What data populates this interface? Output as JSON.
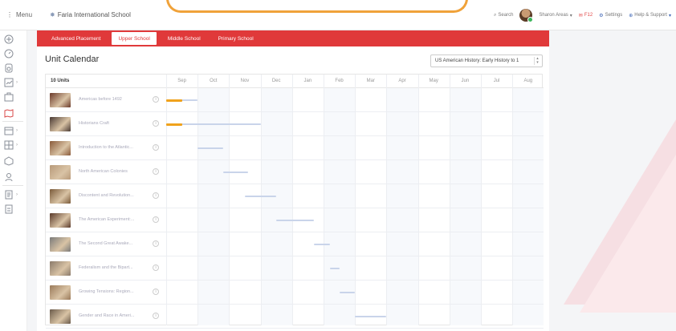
{
  "topbar": {
    "menu_label": "Menu",
    "school_name": "Faria International School",
    "search_label": "Search",
    "user_name": "Sharon Areas",
    "grades_label": "F12",
    "settings_label": "Settings",
    "help_label": "Help & Support"
  },
  "tabs": [
    {
      "label": "Advanced Placement",
      "active": false
    },
    {
      "label": "Upper School",
      "active": true
    },
    {
      "label": "Middle School",
      "active": false
    },
    {
      "label": "Primary School",
      "active": false
    }
  ],
  "page": {
    "title": "Unit Calendar",
    "course_select": "US American History: Early History to 1"
  },
  "calendar": {
    "units_label": "10 Units",
    "months": [
      "Sep",
      "Oct",
      "Nov",
      "Dec",
      "Jan",
      "Feb",
      "Mar",
      "Apr",
      "May",
      "Jun",
      "Jul",
      "Aug"
    ],
    "units": [
      {
        "name": "Americas before 1492",
        "color": "#6b3a2a",
        "start": 0.0,
        "length": 1.0,
        "highlight": 0.5
      },
      {
        "name": "Historians Craft",
        "color": "#4a3a34",
        "start": 0.0,
        "length": 3.0,
        "highlight": 0.5
      },
      {
        "name": "Introduction to the Atlantic...",
        "color": "#8a5a3a",
        "start": 1.0,
        "length": 0.8,
        "highlight": 0
      },
      {
        "name": "North American Colonies",
        "color": "#b89a7a",
        "start": 1.8,
        "length": 0.8,
        "highlight": 0
      },
      {
        "name": "Discontent and Revolution...",
        "color": "#7a5a3a",
        "start": 2.5,
        "length": 1.0,
        "highlight": 0
      },
      {
        "name": "The American Experiment:...",
        "color": "#5a3a2a",
        "start": 3.5,
        "length": 1.2,
        "highlight": 0
      },
      {
        "name": "The Second Great Awake...",
        "color": "#7a7a7a",
        "start": 4.7,
        "length": 0.5,
        "highlight": 0
      },
      {
        "name": "Federalism and the Bipart...",
        "color": "#8a7a6a",
        "start": 5.2,
        "length": 0.3,
        "highlight": 0
      },
      {
        "name": "Growing Tensions: Region...",
        "color": "#9a7a5a",
        "start": 5.5,
        "length": 0.5,
        "highlight": 0
      },
      {
        "name": "Gender and Race in Ameri...",
        "color": "#6a5a4a",
        "start": 6.0,
        "length": 1.0,
        "highlight": 0
      }
    ]
  }
}
